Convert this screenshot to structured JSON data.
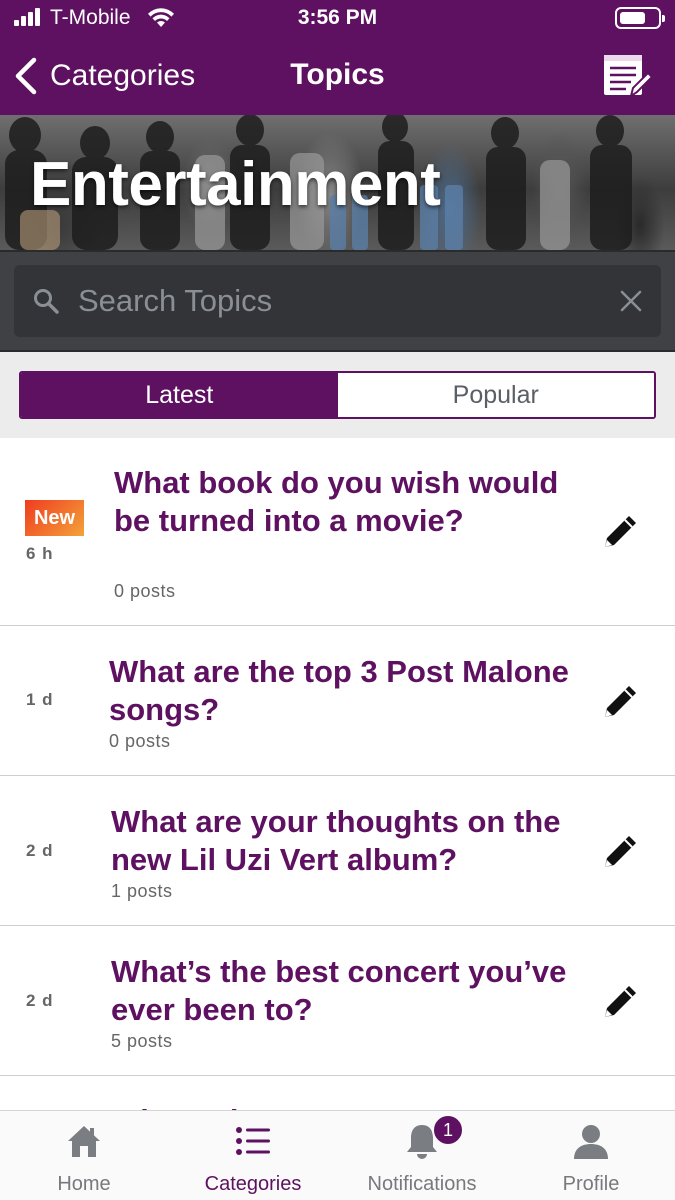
{
  "status_bar": {
    "carrier": "T-Mobile",
    "time": "3:56 PM",
    "battery_level": 0.7
  },
  "nav": {
    "back_label": "Categories",
    "title": "Topics",
    "compose_icon": "compose-list-icon"
  },
  "banner": {
    "title": "Entertainment"
  },
  "search": {
    "placeholder": "Search Topics",
    "value": ""
  },
  "segments": {
    "latest": "Latest",
    "popular": "Popular",
    "selected": "latest"
  },
  "topics": [
    {
      "age": "6 h",
      "is_new": true,
      "new_label": "New",
      "title": "What book do you wish would be turned into a movie?",
      "posts": "0 posts"
    },
    {
      "age": "1 d",
      "is_new": false,
      "title": "What are the top 3 Post Malone songs?",
      "posts": "0 posts"
    },
    {
      "age": "2 d",
      "is_new": false,
      "title": "What are your thoughts on the new Lil Uzi Vert album?",
      "posts": "1 posts"
    },
    {
      "age": "2 d",
      "is_new": false,
      "title": "What’s the best concert you’ve ever been to?",
      "posts": "5 posts"
    },
    {
      "age": "",
      "is_new": false,
      "title": "What ... k ...",
      "posts": ""
    }
  ],
  "tab_bar": {
    "home": "Home",
    "categories": "Categories",
    "notifications": "Notifications",
    "notifications_badge": "1",
    "profile": "Profile",
    "active": "categories"
  },
  "colors": {
    "brand": "#5e1160",
    "new_badge_start": "#ef3c1f",
    "new_badge_end": "#f4a23a",
    "search_bg": "#3f4145"
  }
}
